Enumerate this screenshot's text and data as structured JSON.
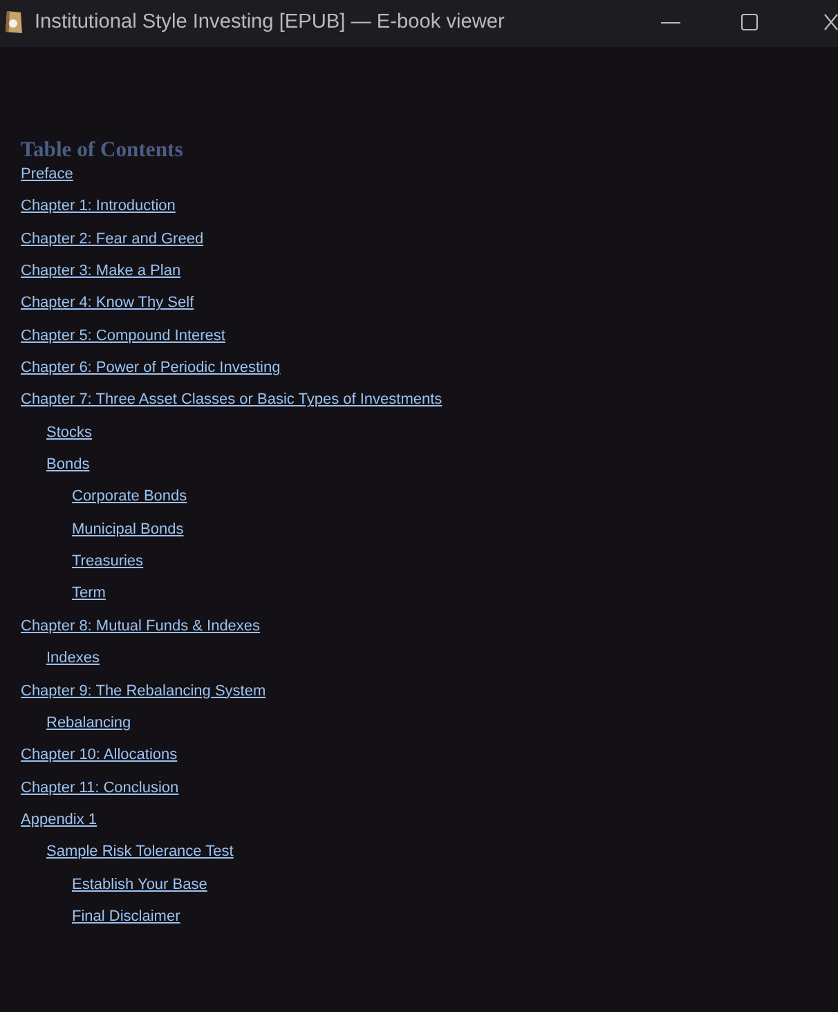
{
  "window": {
    "title": "Institutional Style Investing [EPUB] — E-book viewer"
  },
  "toc": {
    "heading": "Table of Contents",
    "items": [
      {
        "label": "Preface"
      },
      {
        "label": "Chapter 1: Introduction"
      },
      {
        "label": "Chapter 2: Fear and Greed"
      },
      {
        "label": "Chapter 3: Make a Plan"
      },
      {
        "label": "Chapter 4: Know Thy Self"
      },
      {
        "label": "Chapter 5: Compound Interest"
      },
      {
        "label": "Chapter 6: Power of Periodic Investing"
      },
      {
        "label": "Chapter 7: Three Asset Classes or Basic Types of Investments",
        "children": [
          {
            "label": "Stocks"
          },
          {
            "label": "Bonds",
            "children": [
              {
                "label": "Corporate Bonds"
              },
              {
                "label": "Municipal Bonds"
              },
              {
                "label": "Treasuries"
              },
              {
                "label": "Term"
              }
            ]
          }
        ]
      },
      {
        "label": "Chapter 8: Mutual Funds & Indexes",
        "children": [
          {
            "label": "Indexes"
          }
        ]
      },
      {
        "label": "Chapter 9: The Rebalancing System",
        "children": [
          {
            "label": "Rebalancing"
          }
        ]
      },
      {
        "label": "Chapter 10: Allocations"
      },
      {
        "label": "Chapter 11: Conclusion"
      },
      {
        "label": "Appendix 1",
        "children": [
          {
            "label": "Sample Risk Tolerance Test",
            "children": [
              {
                "label": "Establish Your Base"
              },
              {
                "label": "Final Disclaimer"
              }
            ]
          }
        ]
      }
    ]
  }
}
